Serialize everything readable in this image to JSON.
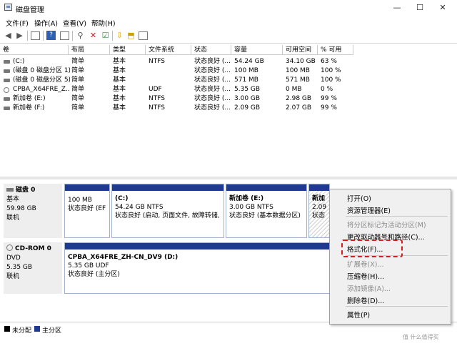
{
  "window": {
    "title": "磁盘管理",
    "minimize": "—",
    "maximize": "☐",
    "close": "✕"
  },
  "menu": [
    "文件(F)",
    "操作(A)",
    "查看(V)",
    "帮助(H)"
  ],
  "toolbar": [
    "back-icon",
    "forward-icon",
    "console-tree-icon",
    "properties-icon",
    "help-icon",
    "refresh-icon",
    "connect-icon",
    "delete-icon",
    "check-icon",
    "export-icon",
    "open-icon",
    "view-icon"
  ],
  "columns": [
    "卷",
    "布局",
    "类型",
    "文件系统",
    "状态",
    "容量",
    "可用空间",
    "% 可用"
  ],
  "rows": [
    {
      "vol": "(C:)",
      "layout": "简单",
      "type": "基本",
      "fs": "NTFS",
      "status": "状态良好 (...",
      "cap": "54.24 GB",
      "free": "34.10 GB",
      "pct": "63 %",
      "icon": "disk"
    },
    {
      "vol": "(磁盘 0 磁盘分区 1)",
      "layout": "简单",
      "type": "基本",
      "fs": "",
      "status": "状态良好 (...",
      "cap": "100 MB",
      "free": "100 MB",
      "pct": "100 %",
      "icon": "disk"
    },
    {
      "vol": "(磁盘 0 磁盘分区 5)",
      "layout": "简单",
      "type": "基本",
      "fs": "",
      "status": "状态良好 (...",
      "cap": "571 MB",
      "free": "571 MB",
      "pct": "100 %",
      "icon": "disk"
    },
    {
      "vol": "CPBA_X64FRE_Z...",
      "layout": "简单",
      "type": "基本",
      "fs": "UDF",
      "status": "状态良好 (...",
      "cap": "5.35 GB",
      "free": "0 MB",
      "pct": "0 %",
      "icon": "cd"
    },
    {
      "vol": "新加卷 (E:)",
      "layout": "简单",
      "type": "基本",
      "fs": "NTFS",
      "status": "状态良好 (...",
      "cap": "3.00 GB",
      "free": "2.98 GB",
      "pct": "99 %",
      "icon": "disk"
    },
    {
      "vol": "新加卷 (F:)",
      "layout": "简单",
      "type": "基本",
      "fs": "NTFS",
      "status": "状态良好 (...",
      "cap": "2.09 GB",
      "free": "2.07 GB",
      "pct": "99 %",
      "icon": "disk"
    }
  ],
  "disk0": {
    "name": "磁盘 0",
    "type": "基本",
    "size": "59.98 GB",
    "state": "联机",
    "p1": {
      "line1": "100 MB",
      "line2": "状态良好 (EFI"
    },
    "p2": {
      "title": "(C:)",
      "line1": "54.24 GB NTFS",
      "line2": "状态良好 (启动, 页面文件, 故障转储, 主"
    },
    "p3": {
      "title": "新加卷 (E:)",
      "line1": "3.00 GB NTFS",
      "line2": "状态良好 (基本数据分区)"
    },
    "p4": {
      "title": "新加",
      "line1": "2.09",
      "line2": "状态"
    }
  },
  "cdrom0": {
    "name": "CD-ROM 0",
    "type": "DVD",
    "size": "5.35 GB",
    "state": "联机",
    "p1": {
      "title": "CPBA_X64FRE_ZH-CN_DV9 (D:)",
      "line1": "5.35 GB UDF",
      "line2": "状态良好 (主分区)"
    }
  },
  "legend": [
    {
      "label": "未分配",
      "color": "#000000"
    },
    {
      "label": "主分区",
      "color": "#1f3b91"
    }
  ],
  "context_menu": [
    {
      "label": "打开(O)",
      "enabled": true
    },
    {
      "label": "资源管理器(E)",
      "enabled": true
    },
    {
      "label": "将分区标记为活动分区(M)",
      "enabled": false
    },
    {
      "label": "更改驱动器号和路径(C)...",
      "enabled": true
    },
    {
      "label": "格式化(F)...",
      "enabled": true
    },
    {
      "label": "扩展卷(X)...",
      "enabled": false
    },
    {
      "label": "压缩卷(H)...",
      "enabled": true
    },
    {
      "label": "添加镜像(A)...",
      "enabled": false
    },
    {
      "label": "删除卷(D)...",
      "enabled": true
    },
    {
      "label": "属性(P)",
      "enabled": true
    }
  ],
  "watermark": "值 什么值得买"
}
